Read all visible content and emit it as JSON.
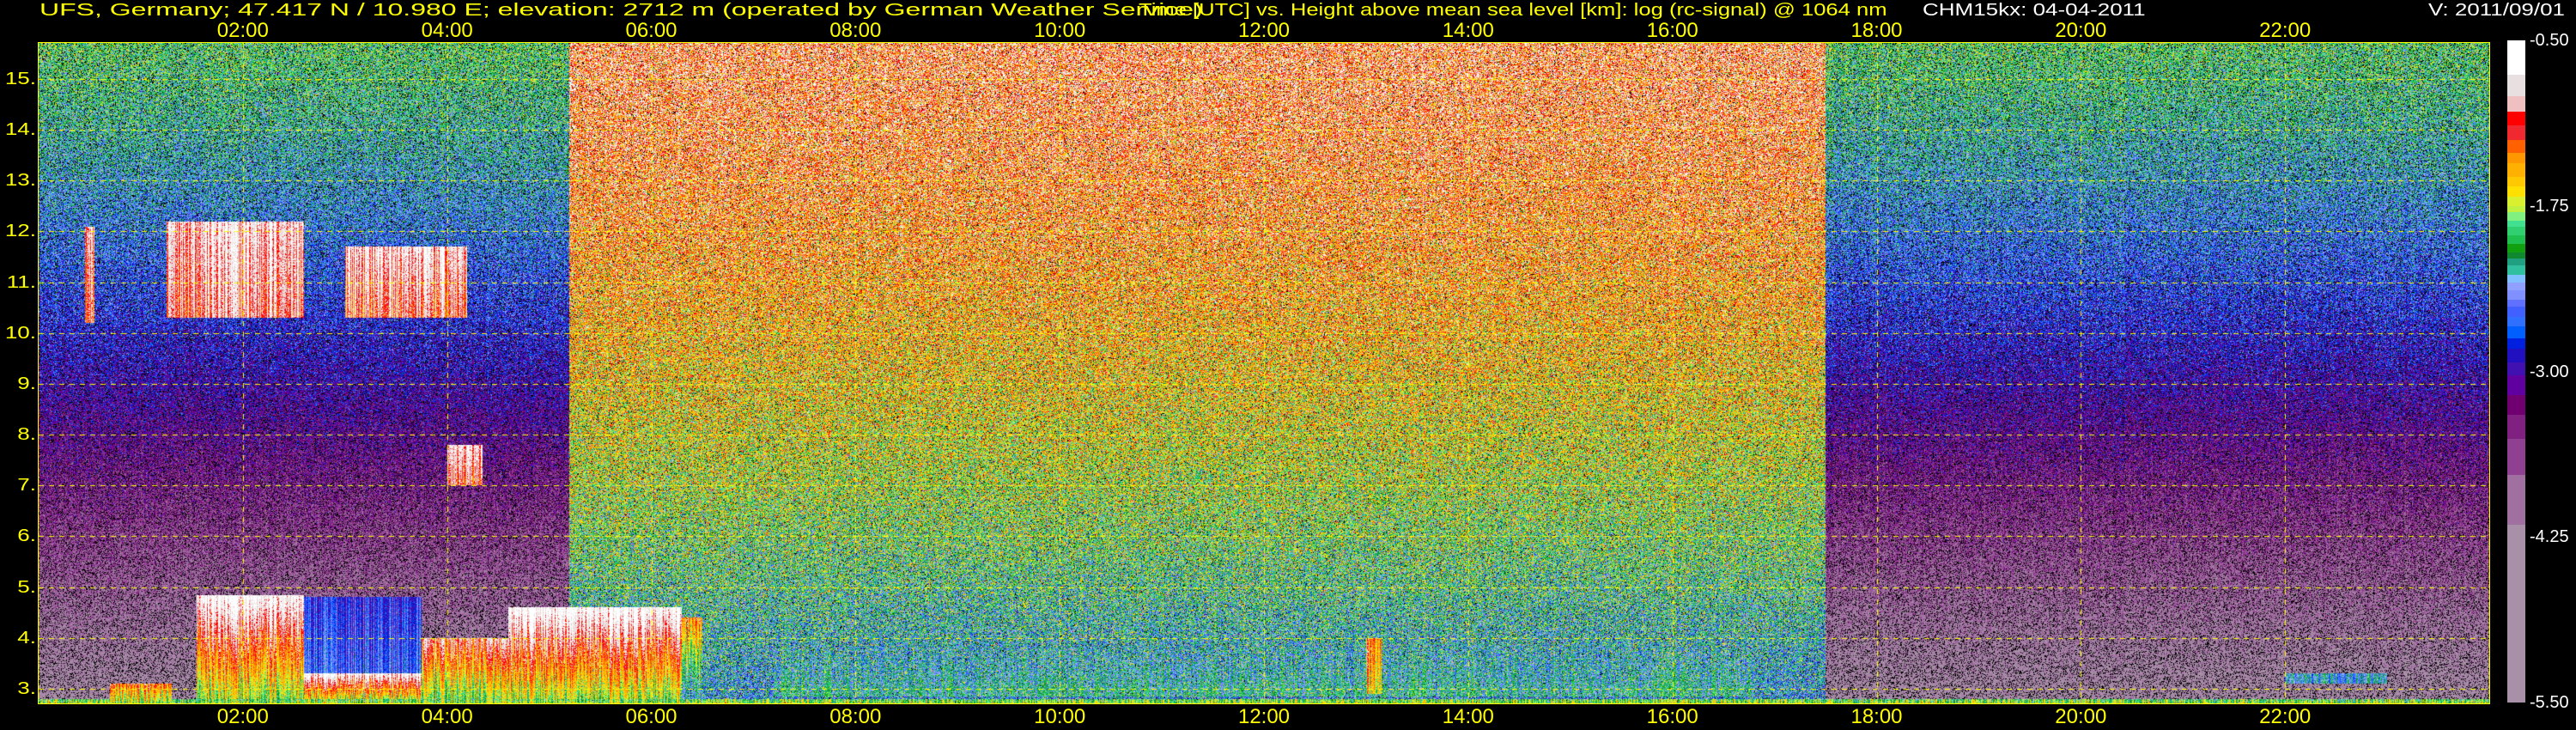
{
  "header": {
    "station": "UFS, Germany; 47.417 N / 10.980 E; elevation: 2712 m  (operated by German Weather Service)",
    "title": "Time [UTC] vs. Height above mean sea level [km]: log (rc-signal) @ 1064 nm",
    "instrument": "CHM15kx: 04-04-2011",
    "version": "V: 2011/09/01"
  },
  "chart_data": {
    "type": "heatmap",
    "title": "Time [UTC] vs. Height above mean sea level [km]: log (rc-signal) @ 1064 nm",
    "xlabel": "Time [UTC]",
    "ylabel": "Height above mean sea level [km]",
    "xlim_hours": [
      0,
      24
    ],
    "ylim_km": [
      2.712,
      15.71
    ],
    "x_ticks": [
      {
        "value": 2,
        "label": "02:00"
      },
      {
        "value": 4,
        "label": "04:00"
      },
      {
        "value": 6,
        "label": "06:00"
      },
      {
        "value": 8,
        "label": "08:00"
      },
      {
        "value": 10,
        "label": "10:00"
      },
      {
        "value": 12,
        "label": "12:00"
      },
      {
        "value": 14,
        "label": "14:00"
      },
      {
        "value": 16,
        "label": "16:00"
      },
      {
        "value": 18,
        "label": "18:00"
      },
      {
        "value": 20,
        "label": "20:00"
      },
      {
        "value": 22,
        "label": "22:00"
      }
    ],
    "y_ticks": [
      {
        "value": 3,
        "label": "3."
      },
      {
        "value": 4,
        "label": "4."
      },
      {
        "value": 5,
        "label": "5."
      },
      {
        "value": 6,
        "label": "6."
      },
      {
        "value": 7,
        "label": "7."
      },
      {
        "value": 8,
        "label": "8."
      },
      {
        "value": 9,
        "label": "9."
      },
      {
        "value": 10,
        "label": "10."
      },
      {
        "value": 11,
        "label": "11."
      },
      {
        "value": 12,
        "label": "12."
      },
      {
        "value": 13,
        "label": "13."
      },
      {
        "value": 14,
        "label": "14."
      },
      {
        "value": 15,
        "label": "15."
      }
    ],
    "grid": true,
    "colorbar": {
      "range": [
        -5.5,
        -0.5
      ],
      "ticks": [
        {
          "value": -0.5,
          "label": "-0.50"
        },
        {
          "value": -1.75,
          "label": "-1.75"
        },
        {
          "value": -3.0,
          "label": "-3.00"
        },
        {
          "value": -4.25,
          "label": "-4.25"
        },
        {
          "value": -5.5,
          "label": "-5.50"
        }
      ],
      "bands": [
        {
          "color": "#ffffff",
          "from": -0.76
        },
        {
          "color": "#e8dfe0",
          "from": -0.92
        },
        {
          "color": "#f0c0c0",
          "from": -1.04
        },
        {
          "color": "#ff0000",
          "from": -1.14
        },
        {
          "color": "#f02830",
          "from": -1.25
        },
        {
          "color": "#ff6000",
          "from": -1.35
        },
        {
          "color": "#ff9800",
          "from": -1.43
        },
        {
          "color": "#ffb000",
          "from": -1.53
        },
        {
          "color": "#ffc800",
          "from": -1.6
        },
        {
          "color": "#ffe000",
          "from": -1.68
        },
        {
          "color": "#d8f030",
          "from": -1.75
        },
        {
          "color": "#c0f040",
          "from": -1.8
        },
        {
          "color": "#80f080",
          "from": -1.86
        },
        {
          "color": "#40e090",
          "from": -1.91
        },
        {
          "color": "#30d070",
          "from": -1.97
        },
        {
          "color": "#20c050",
          "from": -2.04
        },
        {
          "color": "#10a010",
          "from": -2.1
        },
        {
          "color": "#108830",
          "from": -2.15
        },
        {
          "color": "#20a080",
          "from": -2.2
        },
        {
          "color": "#30c0a0",
          "from": -2.27
        },
        {
          "color": "#80c0ff",
          "from": -2.33
        },
        {
          "color": "#90a0ff",
          "from": -2.39
        },
        {
          "color": "#8090ff",
          "from": -2.46
        },
        {
          "color": "#6070ff",
          "from": -2.51
        },
        {
          "color": "#4060ff",
          "from": -2.59
        },
        {
          "color": "#3070ff",
          "from": -2.66
        },
        {
          "color": "#0060ff",
          "from": -2.75
        },
        {
          "color": "#0020e0",
          "from": -2.83
        },
        {
          "color": "#2010c0",
          "from": -2.93
        },
        {
          "color": "#4010b0",
          "from": -3.03
        },
        {
          "color": "#6000a0",
          "from": -3.18
        },
        {
          "color": "#700070",
          "from": -3.33
        },
        {
          "color": "#802080",
          "from": -3.51
        },
        {
          "color": "#904090",
          "from": -3.78
        },
        {
          "color": "#a070a0",
          "from": -4.16
        },
        {
          "color": "#a890a8",
          "from": -5.5
        }
      ]
    },
    "background_regimes": [
      {
        "hours": [
          0,
          5.2
        ],
        "value_top": -2.0,
        "value_bottom": -4.4
      },
      {
        "hours": [
          5.2,
          17.5
        ],
        "value_top": -1.1,
        "value_bottom": -2.4
      },
      {
        "hours": [
          17.5,
          24
        ],
        "value_top": -2.0,
        "value_bottom": -4.4
      }
    ],
    "features": [
      {
        "hours": [
          0,
          24
        ],
        "height_km": [
          2.712,
          2.8
        ],
        "value_top": -2.0,
        "value_bottom": -1.8
      },
      {
        "hours": [
          0.45,
          0.55
        ],
        "height_km": [
          10.2,
          12.1
        ],
        "value_top": -1.0,
        "value_bottom": -1.2
      },
      {
        "hours": [
          1.25,
          2.6
        ],
        "height_km": [
          10.3,
          12.2
        ],
        "value_top": -0.8,
        "value_bottom": -1.0
      },
      {
        "hours": [
          3.0,
          4.2
        ],
        "height_km": [
          10.3,
          11.7
        ],
        "value_top": -0.8,
        "value_bottom": -1.1
      },
      {
        "hours": [
          4.0,
          4.35
        ],
        "height_km": [
          7.0,
          7.8
        ],
        "value_top": -0.8,
        "value_bottom": -1.1
      },
      {
        "hours": [
          0.7,
          1.3
        ],
        "height_km": [
          2.75,
          3.1
        ],
        "value_top": -1.3,
        "value_bottom": -1.8
      },
      {
        "hours": [
          1.55,
          2.6
        ],
        "height_km": [
          2.8,
          4.85
        ],
        "value_top": -0.6,
        "value_bottom": -1.8
      },
      {
        "hours": [
          2.6,
          3.75
        ],
        "height_km": [
          3.3,
          4.8
        ],
        "value_top": -2.8,
        "value_bottom": -2.6
      },
      {
        "hours": [
          2.6,
          3.75
        ],
        "height_km": [
          2.8,
          3.3
        ],
        "value_top": -0.7,
        "value_bottom": -1.7
      },
      {
        "hours": [
          3.75,
          4.6
        ],
        "height_km": [
          2.8,
          4.0
        ],
        "value_top": -1.0,
        "value_bottom": -1.9
      },
      {
        "hours": [
          4.6,
          6.3
        ],
        "height_km": [
          2.8,
          4.6
        ],
        "value_top": -0.6,
        "value_bottom": -1.8
      },
      {
        "hours": [
          6.3,
          6.5
        ],
        "height_km": [
          2.8,
          4.4
        ],
        "value_top": -1.3,
        "value_bottom": -2.5
      },
      {
        "hours": [
          7.2,
          16.8
        ],
        "height_km": [
          2.85,
          3.8
        ],
        "value_top": -2.7,
        "value_bottom": -2.2
      },
      {
        "hours": [
          13.0,
          13.15
        ],
        "height_km": [
          2.9,
          4.0
        ],
        "value_top": -1.3,
        "value_bottom": -1.6
      },
      {
        "hours": [
          22.0,
          23.0
        ],
        "height_km": [
          3.1,
          3.3
        ],
        "value_top": -2.3,
        "value_bottom": -2.3
      }
    ]
  }
}
